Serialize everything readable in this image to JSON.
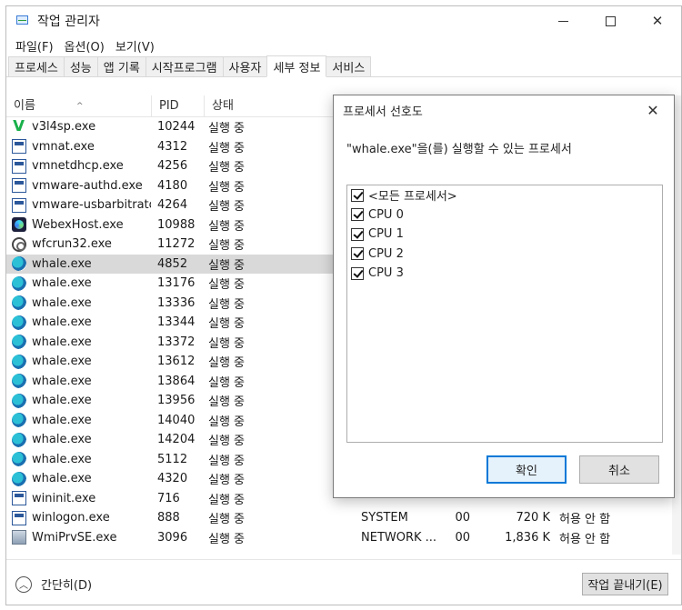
{
  "window": {
    "title": "작업 관리자",
    "controls": {
      "minimize": "minimize",
      "maximize": "maximize",
      "close": "✕"
    }
  },
  "menu": [
    "파일(F)",
    "옵션(O)",
    "보기(V)"
  ],
  "tabs": [
    {
      "label": "프로세스",
      "active": false
    },
    {
      "label": "성능",
      "active": false
    },
    {
      "label": "앱 기록",
      "active": false
    },
    {
      "label": "시작프로그램",
      "active": false
    },
    {
      "label": "사용자",
      "active": false
    },
    {
      "label": "세부 정보",
      "active": true
    },
    {
      "label": "서비스",
      "active": false
    }
  ],
  "table": {
    "headers": {
      "name": "이름",
      "pid": "PID",
      "status": "상태"
    },
    "rows": [
      {
        "name": "v3l4sp.exe",
        "pid": "10244",
        "status": "실행 중",
        "user": "",
        "cpu": "",
        "mem": "",
        "uac": "",
        "icon": "v3-icon"
      },
      {
        "name": "vmnat.exe",
        "pid": "4312",
        "status": "실행 중",
        "user": "",
        "cpu": "",
        "mem": "",
        "uac": "",
        "icon": "app-icon"
      },
      {
        "name": "vmnetdhcp.exe",
        "pid": "4256",
        "status": "실행 중",
        "user": "",
        "cpu": "",
        "mem": "",
        "uac": "",
        "icon": "app-icon"
      },
      {
        "name": "vmware-authd.exe",
        "pid": "4180",
        "status": "실행 중",
        "user": "",
        "cpu": "",
        "mem": "",
        "uac": "",
        "icon": "app-icon"
      },
      {
        "name": "vmware-usbarbitrato...",
        "pid": "4264",
        "status": "실행 중",
        "user": "",
        "cpu": "",
        "mem": "",
        "uac": "",
        "icon": "app-icon"
      },
      {
        "name": "WebexHost.exe",
        "pid": "10988",
        "status": "실행 중",
        "user": "",
        "cpu": "",
        "mem": "",
        "uac": "",
        "icon": "webex-icon"
      },
      {
        "name": "wfcrun32.exe",
        "pid": "11272",
        "status": "실행 중",
        "user": "",
        "cpu": "",
        "mem": "",
        "uac": "",
        "icon": "citrix-icon"
      },
      {
        "name": "whale.exe",
        "pid": "4852",
        "status": "실행 중",
        "user": "",
        "cpu": "",
        "mem": "",
        "uac": "",
        "icon": "whale-icon",
        "selected": true
      },
      {
        "name": "whale.exe",
        "pid": "13176",
        "status": "실행 중",
        "user": "",
        "cpu": "",
        "mem": "",
        "uac": "",
        "icon": "whale-icon"
      },
      {
        "name": "whale.exe",
        "pid": "13336",
        "status": "실행 중",
        "user": "",
        "cpu": "",
        "mem": "",
        "uac": "",
        "icon": "whale-icon"
      },
      {
        "name": "whale.exe",
        "pid": "13344",
        "status": "실행 중",
        "user": "",
        "cpu": "",
        "mem": "",
        "uac": "",
        "icon": "whale-icon"
      },
      {
        "name": "whale.exe",
        "pid": "13372",
        "status": "실행 중",
        "user": "",
        "cpu": "",
        "mem": "",
        "uac": "",
        "icon": "whale-icon"
      },
      {
        "name": "whale.exe",
        "pid": "13612",
        "status": "실행 중",
        "user": "",
        "cpu": "",
        "mem": "",
        "uac": "",
        "icon": "whale-icon"
      },
      {
        "name": "whale.exe",
        "pid": "13864",
        "status": "실행 중",
        "user": "",
        "cpu": "",
        "mem": "",
        "uac": "",
        "icon": "whale-icon"
      },
      {
        "name": "whale.exe",
        "pid": "13956",
        "status": "실행 중",
        "user": "",
        "cpu": "",
        "mem": "",
        "uac": "",
        "icon": "whale-icon"
      },
      {
        "name": "whale.exe",
        "pid": "14040",
        "status": "실행 중",
        "user": "",
        "cpu": "",
        "mem": "",
        "uac": "",
        "icon": "whale-icon"
      },
      {
        "name": "whale.exe",
        "pid": "14204",
        "status": "실행 중",
        "user": "",
        "cpu": "",
        "mem": "",
        "uac": "",
        "icon": "whale-icon"
      },
      {
        "name": "whale.exe",
        "pid": "5112",
        "status": "실행 중",
        "user": "",
        "cpu": "",
        "mem": "",
        "uac": "",
        "icon": "whale-icon"
      },
      {
        "name": "whale.exe",
        "pid": "4320",
        "status": "실행 중",
        "user": "",
        "cpu": "",
        "mem": "",
        "uac": "",
        "icon": "whale-icon"
      },
      {
        "name": "wininit.exe",
        "pid": "716",
        "status": "실행 중",
        "user": "",
        "cpu": "",
        "mem": "",
        "uac": "",
        "icon": "app-icon"
      },
      {
        "name": "winlogon.exe",
        "pid": "888",
        "status": "실행 중",
        "user": "SYSTEM",
        "cpu": "00",
        "mem": "720 K",
        "uac": "허용 안 함",
        "icon": "app-icon"
      },
      {
        "name": "WmiPrvSE.exe",
        "pid": "3096",
        "status": "실행 중",
        "user": "NETWORK ...",
        "cpu": "00",
        "mem": "1,836 K",
        "uac": "허용 안 함",
        "icon": "wmi-icon"
      }
    ]
  },
  "footer": {
    "collapse_label": "간단히(D)",
    "end_task_label": "작업 끝내기(E)"
  },
  "dialog": {
    "title": "프로세서 선호도",
    "close": "✕",
    "description": "\"whale.exe\"을(를) 실행할 수 있는 프로세서",
    "items": [
      {
        "label": "<모든 프로세서>",
        "checked": true
      },
      {
        "label": "CPU 0",
        "checked": true
      },
      {
        "label": "CPU 1",
        "checked": true
      },
      {
        "label": "CPU 2",
        "checked": true
      },
      {
        "label": "CPU 3",
        "checked": true
      }
    ],
    "ok_label": "확인",
    "cancel_label": "취소"
  }
}
